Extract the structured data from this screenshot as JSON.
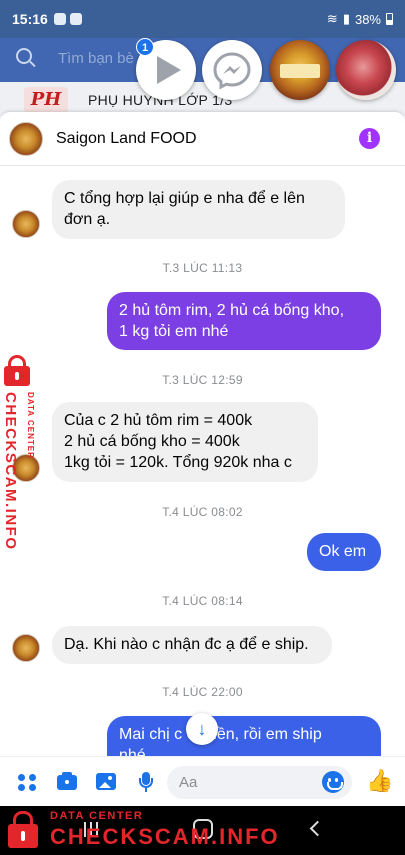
{
  "status_bar": {
    "time": "15:16",
    "battery": "38%"
  },
  "fb_background": {
    "search_placeholder": "Tìm bạn bè",
    "group_logo": "PH",
    "group_title": "PHỤ HUYNH LỚP 1/3"
  },
  "chat_heads": {
    "badge_count": "1",
    "items": [
      "video-play",
      "messenger",
      "product-photo",
      "meat-photo"
    ]
  },
  "chat": {
    "contact_name": "Saigon Land FOOD",
    "messages": [
      {
        "dir": "in",
        "text_lines": [
          "C tổng hợp lại giúp e nha để e lên",
          "đơn ạ."
        ]
      },
      {
        "timestamp": "T.3 LÚC 11:13"
      },
      {
        "dir": "out",
        "text_lines": [
          "2 hủ tôm rim, 2 hủ cá bống kho,",
          "1 kg tỏi em nhé"
        ]
      },
      {
        "timestamp": "T.3 LÚC 12:59"
      },
      {
        "dir": "in",
        "text_lines": [
          "Của c 2 hủ tôm rim = 400k",
          "2 hủ cá bống kho = 400k",
          "1kg tỏi = 120k. Tổng 920k nha c"
        ]
      },
      {
        "timestamp": "T.4 LÚC 08:02"
      },
      {
        "dir": "out",
        "text_lines": [
          "Ok em"
        ]
      },
      {
        "timestamp": "T.4 LÚC 08:14"
      },
      {
        "dir": "in",
        "text_lines": [
          "Dạ. Khi nào c nhận đc ạ để e ship."
        ]
      },
      {
        "timestamp": "T.4 LÚC 22:00"
      },
      {
        "dir": "out",
        "text_lines": [
          "Mai chị c   ển tiền, rồi em ship",
          "nhé"
        ]
      }
    ]
  },
  "composer": {
    "placeholder": "Aa"
  },
  "watermark": {
    "small": "DATA CENTER",
    "big": "CHECKSCAM.INFO"
  },
  "colors": {
    "outgoing_purple": "#7b3fe4",
    "outgoing_blue": "#3b61e8",
    "incoming": "#f0f0f0",
    "accent": "#1a73e8",
    "watermark": "#e3262b"
  }
}
